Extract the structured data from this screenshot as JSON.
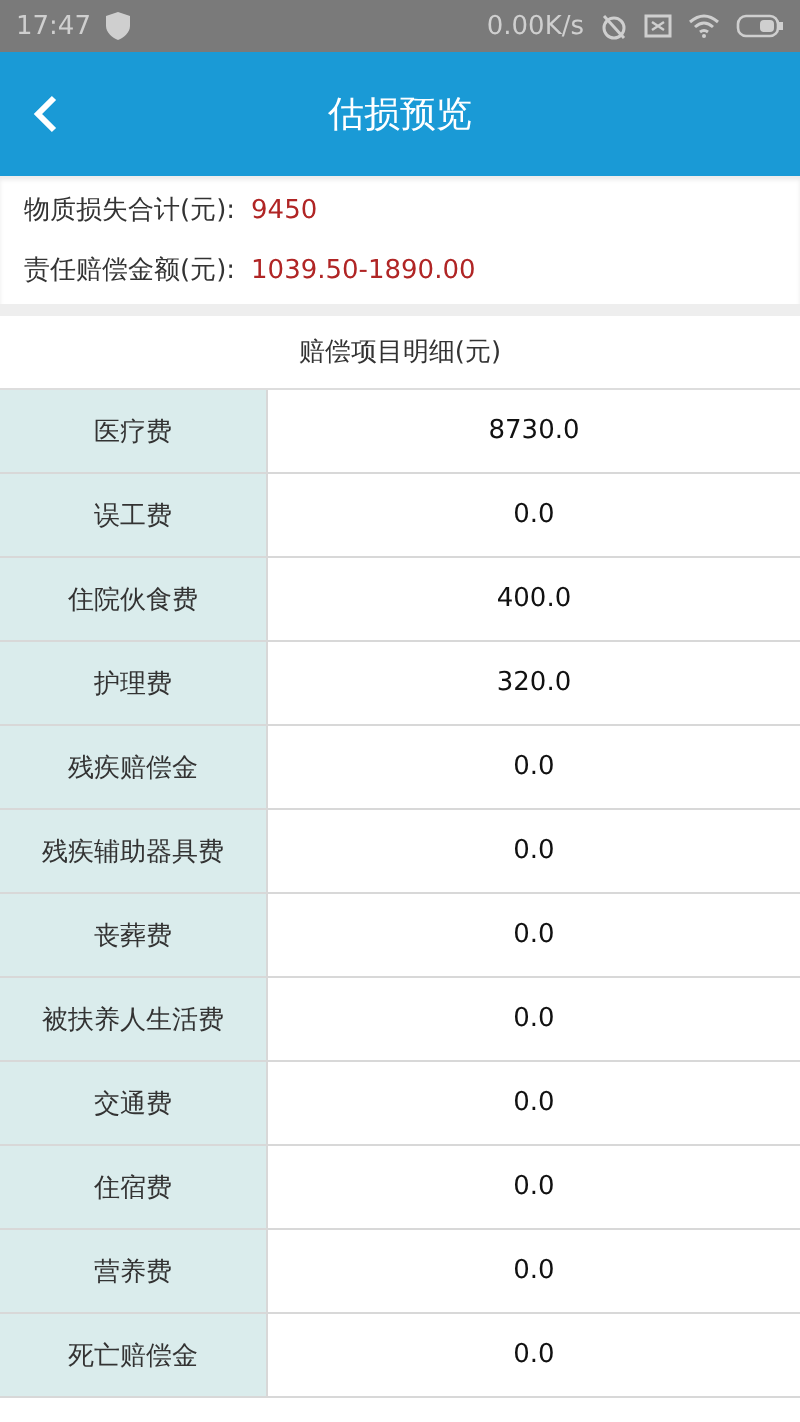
{
  "status_bar": {
    "time": "17:47",
    "speed": "0.00K/s"
  },
  "header": {
    "title": "估损预览"
  },
  "summary": [
    {
      "label": "物质损失合计(元):",
      "value": "9450"
    },
    {
      "label": "责任赔偿金额(元):",
      "value": "1039.50-1890.00"
    }
  ],
  "table": {
    "title": "赔偿项目明细(元)",
    "rows": [
      {
        "item": "医疗费",
        "amount": "8730.0"
      },
      {
        "item": "误工费",
        "amount": "0.0"
      },
      {
        "item": "住院伙食费",
        "amount": "400.0"
      },
      {
        "item": "护理费",
        "amount": "320.0"
      },
      {
        "item": "残疾赔偿金",
        "amount": "0.0"
      },
      {
        "item": "残疾辅助器具费",
        "amount": "0.0"
      },
      {
        "item": "丧葬费",
        "amount": "0.0"
      },
      {
        "item": "被扶养人生活费",
        "amount": "0.0"
      },
      {
        "item": "交通费",
        "amount": "0.0"
      },
      {
        "item": "住宿费",
        "amount": "0.0"
      },
      {
        "item": "营养费",
        "amount": "0.0"
      },
      {
        "item": "死亡赔偿金",
        "amount": "0.0"
      }
    ]
  }
}
